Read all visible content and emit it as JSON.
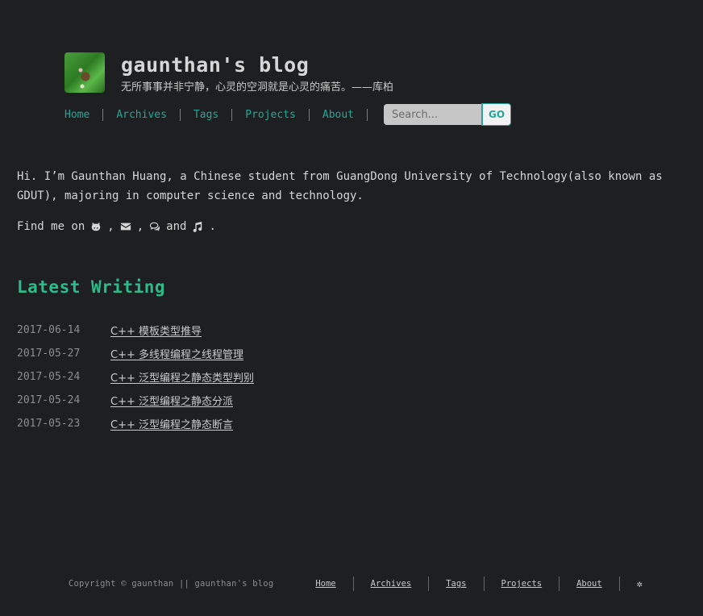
{
  "header": {
    "title": "gaunthan's blog",
    "subtitle": "无所事事并非宁静，心灵的空洞就是心灵的痛苦。——库柏"
  },
  "nav": {
    "items": [
      {
        "label": "Home"
      },
      {
        "label": "Archives"
      },
      {
        "label": "Tags"
      },
      {
        "label": "Projects"
      },
      {
        "label": "About"
      }
    ]
  },
  "search": {
    "placeholder": "Search...",
    "button_label": "GO"
  },
  "intro": {
    "text": "Hi. I’m Gaunthan Huang, a Chinese student from GuangDong University of Technology(also known as GDUT), majoring in computer science and technology."
  },
  "find_me": {
    "prefix": "Find me on",
    "sep": ",",
    "and": "and",
    "end": ".",
    "icons": [
      "github-icon",
      "envelope-icon",
      "comments-icon",
      "music-icon"
    ]
  },
  "latest": {
    "title": "Latest Writing",
    "posts": [
      {
        "date": "2017-06-14",
        "title": "C++ 模板类型推导"
      },
      {
        "date": "2017-05-27",
        "title": "C++ 多线程编程之线程管理"
      },
      {
        "date": "2017-05-24",
        "title": "C++ 泛型编程之静态类型判别"
      },
      {
        "date": "2017-05-24",
        "title": "C++ 泛型编程之静态分派"
      },
      {
        "date": "2017-05-23",
        "title": "C++ 泛型编程之静态断言"
      }
    ]
  },
  "footer": {
    "copyright": "Copyright © gaunthan || gaunthan's blog",
    "links": [
      {
        "label": "Home"
      },
      {
        "label": "Archives"
      },
      {
        "label": "Tags"
      },
      {
        "label": "Projects"
      },
      {
        "label": "About"
      }
    ],
    "gear": "✲"
  },
  "colors": {
    "background": "#1d1f21",
    "accent": "#2bbc8a",
    "nav_link": "#26a69a",
    "text": "#d6d6d6",
    "muted": "#8d8d8d"
  }
}
